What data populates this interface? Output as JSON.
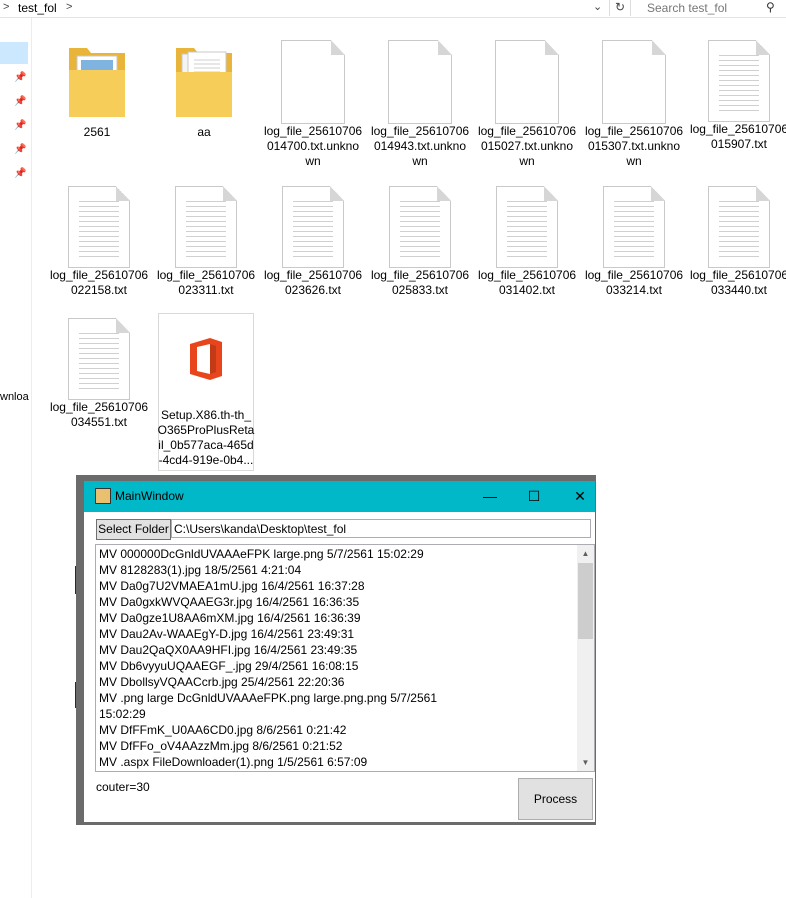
{
  "explorer": {
    "breadcrumb": "test_fol",
    "search_placeholder": "Search test_fol",
    "nav_cut_label": "wnloa",
    "items": [
      {
        "label": "2561",
        "type": "folder"
      },
      {
        "label": "aa",
        "type": "folder-docs"
      },
      {
        "label": "log_file_25610706 014700.txt.unkno wn",
        "type": "blank"
      },
      {
        "label": "log_file_25610706 014943.txt.unkno wn",
        "type": "blank"
      },
      {
        "label": "log_file_25610706 015027.txt.unkno wn",
        "type": "blank"
      },
      {
        "label": "log_file_25610706 015307.txt.unkno wn",
        "type": "blank"
      },
      {
        "label": "log_file_25610706 015907.txt",
        "type": "text"
      },
      {
        "label": "log_file_25610706 022158.txt",
        "type": "text"
      },
      {
        "label": "log_file_25610706 023311.txt",
        "type": "text"
      },
      {
        "label": "log_file_25610706 023626.txt",
        "type": "text"
      },
      {
        "label": "log_file_25610706 025833.txt",
        "type": "text"
      },
      {
        "label": "log_file_25610706 031402.txt",
        "type": "text"
      },
      {
        "label": "log_file_25610706 033214.txt",
        "type": "text"
      },
      {
        "label": "log_file_25610706 033440.txt",
        "type": "text"
      },
      {
        "label": "log_file_25610706 034551.txt",
        "type": "text"
      },
      {
        "label": "Setup.X86.th-th_ O365ProPlusReta il_0b577aca-465d -4cd4-919e-0b4...",
        "type": "office"
      }
    ]
  },
  "main_window": {
    "title": "MainWindow",
    "select_folder_label": "Select Folder",
    "folder_path": "C:\\Users\\kanda\\Desktop\\test_fol",
    "rows": [
      "MV                    000000DcGnldUVAAAeFPK large.png            5/7/2561 15:02:29",
      "MV                    8128283(1).jpg      18/5/2561 4:21:04",
      "MV                    Da0g7U2VMAEA1mU.jpg    16/4/2561 16:37:28",
      "MV                    Da0gxkWVQAAEG3r.jpg     16/4/2561 16:36:35",
      "MV                    Da0gze1U8AA6mXM.jpg     16/4/2561 16:36:39",
      "MV                    Dau2Av-WAAEgY-D.jpg     16/4/2561 23:49:31",
      "MV                    Dau2QaQX0AA9HFI.jpg     16/4/2561 23:49:35",
      "MV                    Db6vyyuUQAAEGF_.jpg     29/4/2561 16:08:15",
      "MV                    DbollsyVQAACcrb.jpg      25/4/2561 22:20:36",
      "MV         .png large              DcGnldUVAAAeFPK.png large.png.png          5/7/2561",
      "15:02:29",
      "MV                    DfFFmK_U0AA6CD0.jpg     8/6/2561 0:21:42",
      "MV                    DfFFo_oV4AAzzMm.jpg     8/6/2561 0:21:52",
      "MV         .aspx      FileDownloader(1).png      1/5/2561 6:57:09"
    ],
    "counter": "couter=30",
    "process_label": "Process"
  },
  "colors": {
    "title_bar": "#00b8c8",
    "folder_yellow": "#f4c84c",
    "office_red": "#e8451d"
  }
}
